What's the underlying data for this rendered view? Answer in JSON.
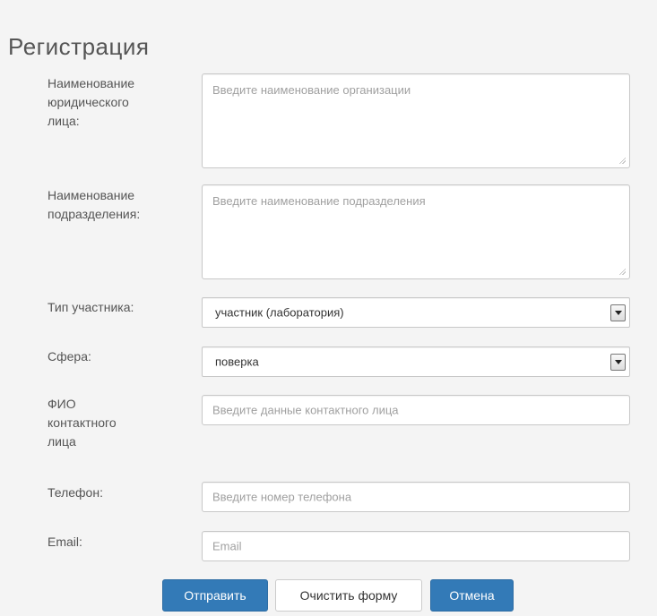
{
  "page": {
    "title": "Регистрация"
  },
  "form": {
    "org_name": {
      "label": "Наименование\nюридического\nлица:",
      "placeholder": "Введите наименование организации"
    },
    "division_name": {
      "label": "Наименование\nподразделения:",
      "placeholder": "Введите наименование подразделения"
    },
    "participant_type": {
      "label": "Тип участника:",
      "value": "участник (лаборатория)"
    },
    "sphere": {
      "label": "Сфера:",
      "value": "поверка"
    },
    "contact_name": {
      "label": "ФИО\nконтактного\nлица",
      "placeholder": "Введите данные контактного лица"
    },
    "phone": {
      "label": "Телефон:",
      "placeholder": "Введите номер телефона"
    },
    "email": {
      "label": "Email:",
      "placeholder": "Email"
    }
  },
  "buttons": {
    "submit": "Отправить",
    "clear": "Очистить форму",
    "cancel": "Отмена"
  },
  "colors": {
    "primary": "#337ab7",
    "background": "#f4f4f4"
  }
}
